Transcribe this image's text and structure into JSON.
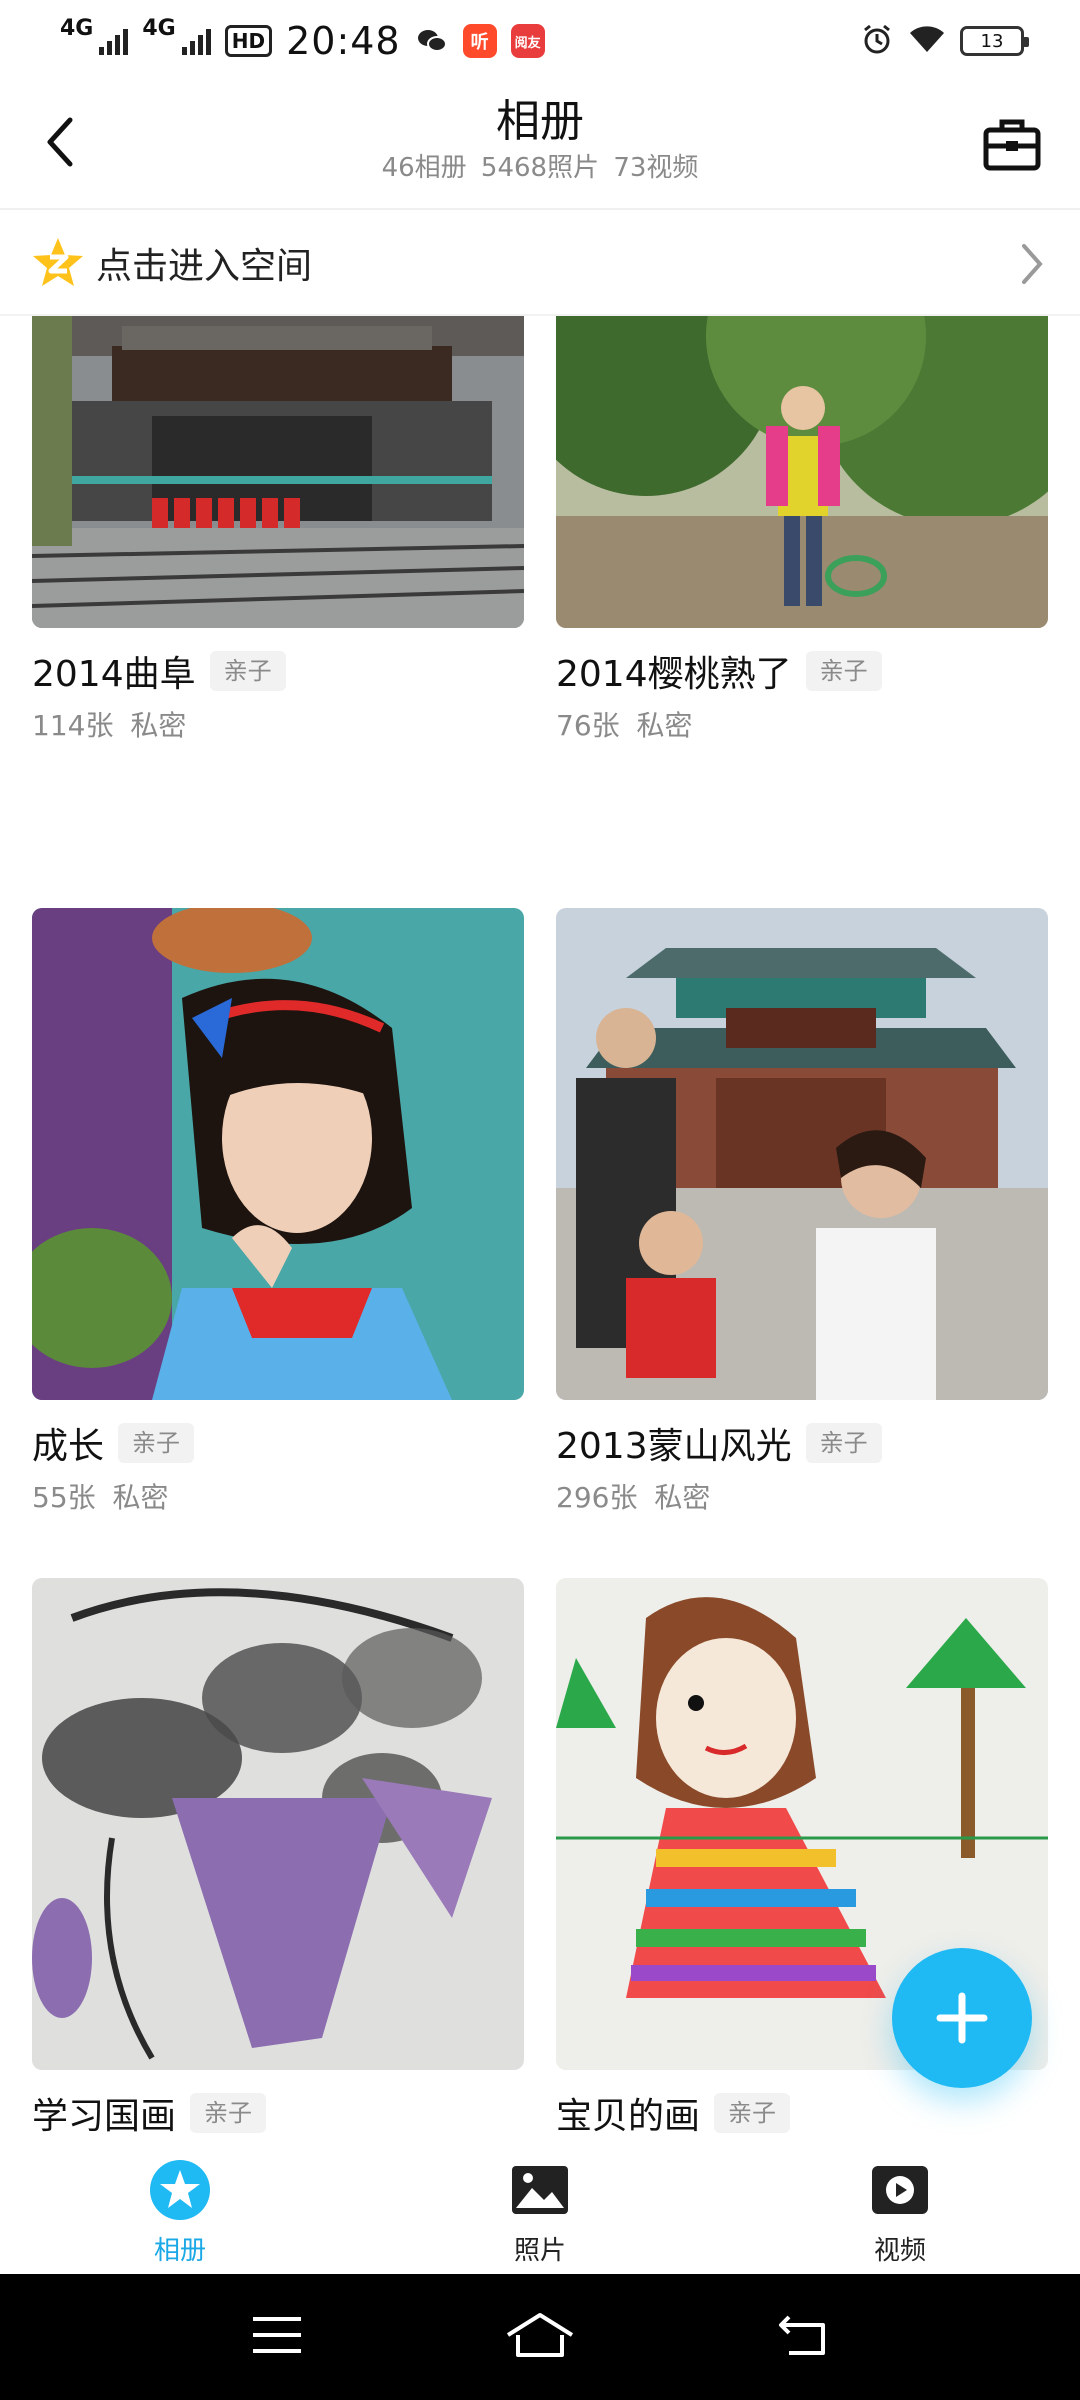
{
  "status_bar": {
    "sim1": "4G",
    "sim2": "4G",
    "hd": "HD",
    "time": "20:48",
    "ting_app": "听",
    "yue_app": "阅友",
    "battery": "13"
  },
  "header": {
    "title": "相册",
    "subtitle": "46相册  5468照片  73视频"
  },
  "space_bar": {
    "label": "点击进入空间"
  },
  "albums": [
    {
      "name": "2014曲阜",
      "tag": "亲子",
      "meta": "114张  私密"
    },
    {
      "name": "2014樱桃熟了",
      "tag": "亲子",
      "meta": "76张  私密"
    },
    {
      "name": "成长",
      "tag": "亲子",
      "meta": "55张  私密"
    },
    {
      "name": "2013蒙山风光",
      "tag": "亲子",
      "meta": "296张  私密"
    },
    {
      "name": "学习国画",
      "tag": "亲子",
      "meta": ""
    },
    {
      "name": "宝贝的画",
      "tag": "亲子",
      "meta": ""
    }
  ],
  "bottom_nav": [
    {
      "label": "相册",
      "active": true
    },
    {
      "label": "照片",
      "active": false
    },
    {
      "label": "视频",
      "active": false
    }
  ],
  "colors": {
    "accent": "#1fb9f3",
    "active_tab": "#1aa9e6",
    "muted_text": "#8a8a8a"
  },
  "icons": [
    "back-arrow-icon",
    "toolbox-icon",
    "qzone-star-icon",
    "chevron-right-icon",
    "plus-icon",
    "album-star-icon",
    "photo-icon",
    "video-play-icon",
    "menu-icon",
    "home-icon",
    "back-icon"
  ]
}
